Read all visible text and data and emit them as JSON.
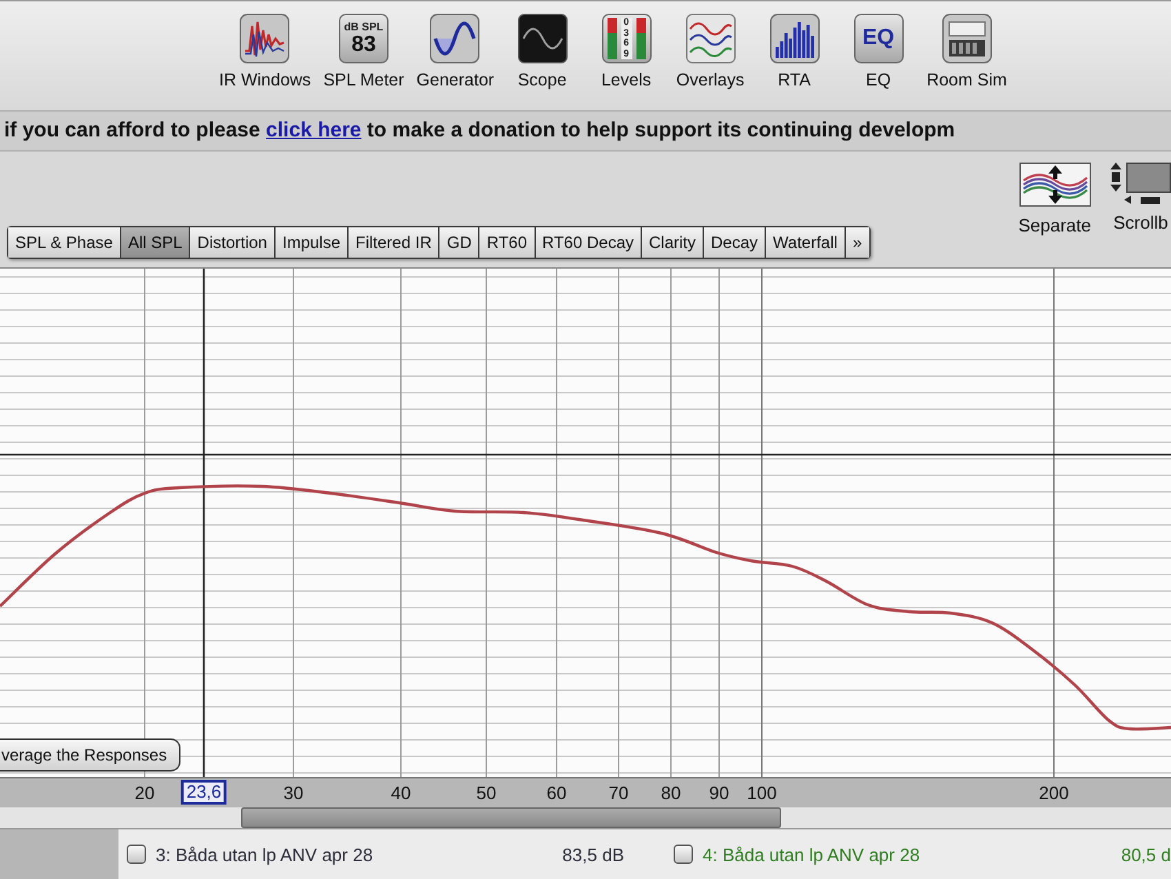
{
  "toolbar": {
    "tools": [
      {
        "label": "IR Windows",
        "kind": "ir"
      },
      {
        "label": "SPL Meter",
        "kind": "spl",
        "icon_text": [
          "dB SPL",
          "83"
        ]
      },
      {
        "label": "Generator",
        "kind": "generator"
      },
      {
        "label": "Scope",
        "kind": "scope"
      },
      {
        "label": "Levels",
        "kind": "levels",
        "icon_text": [
          "0",
          "3",
          "6",
          "9"
        ]
      },
      {
        "label": "Overlays",
        "kind": "overlays"
      },
      {
        "label": "RTA",
        "kind": "rta"
      },
      {
        "label": "EQ",
        "kind": "eq",
        "icon_text": [
          "EQ"
        ]
      },
      {
        "label": "Room Sim",
        "kind": "roomsim"
      }
    ]
  },
  "banner": {
    "text_before": "if you can afford to please",
    "link": "click here",
    "text_after": "to make a donation to help support its continuing developm"
  },
  "view_buttons": [
    {
      "label": "Separate",
      "kind": "separate"
    },
    {
      "label": "Scrollb",
      "kind": "scrollbars"
    }
  ],
  "tabs": [
    {
      "label": "SPL & Phase",
      "selected": false
    },
    {
      "label": "All SPL",
      "selected": true
    },
    {
      "label": "Distortion",
      "selected": false
    },
    {
      "label": "Impulse",
      "selected": false
    },
    {
      "label": "Filtered IR",
      "selected": false
    },
    {
      "label": "GD",
      "selected": false
    },
    {
      "label": "RT60",
      "selected": false
    },
    {
      "label": "RT60 Decay",
      "selected": false
    },
    {
      "label": "Clarity",
      "selected": false
    },
    {
      "label": "Decay",
      "selected": false
    },
    {
      "label": "Waterfall",
      "selected": false
    },
    {
      "label": "»",
      "selected": false
    }
  ],
  "graph": {
    "average_button": "verage the Responses",
    "x_axis_labels": [
      "20",
      "30",
      "40",
      "50",
      "60",
      "70",
      "80",
      "90",
      "100",
      "200"
    ],
    "cursor_readout": "23,6"
  },
  "legend": [
    {
      "checked": false,
      "name": "3: Båda utan lp ANV apr 28",
      "value": "83,5 dB",
      "color": "#2c2c3a"
    },
    {
      "checked": false,
      "name": "4: Båda utan lp ANV apr 28",
      "value": "80,5 d",
      "color": "#2e7d1f"
    }
  ]
}
